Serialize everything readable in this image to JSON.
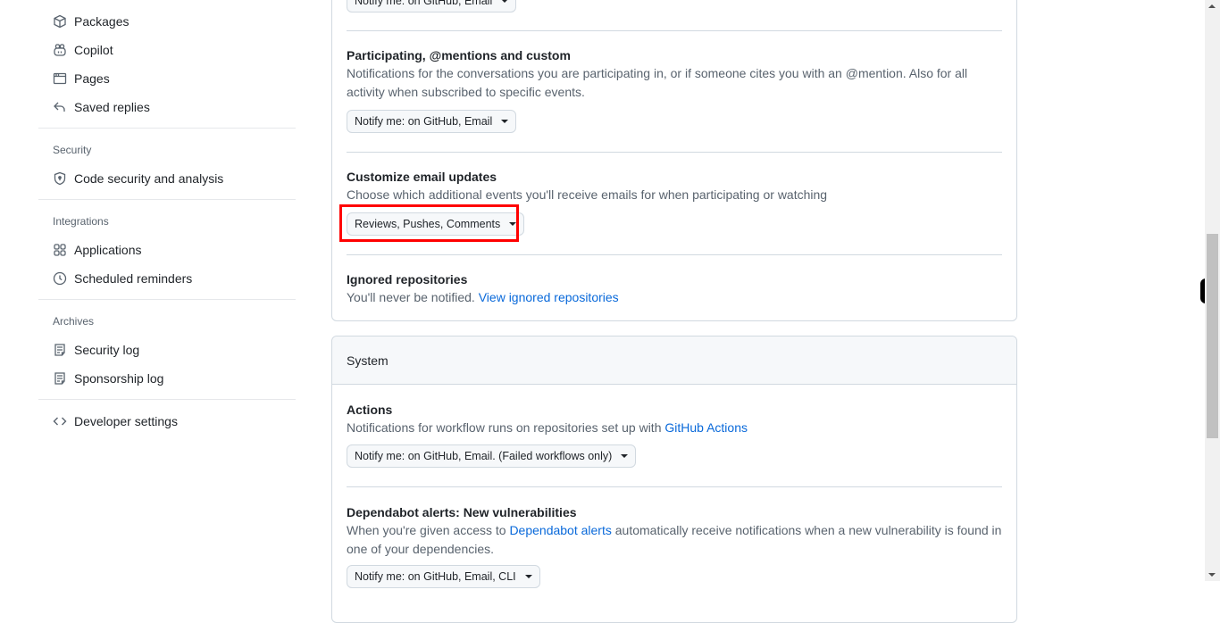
{
  "sidebar": {
    "items_top": [
      {
        "label": "Packages",
        "icon": "package-icon"
      },
      {
        "label": "Copilot",
        "icon": "copilot-icon"
      },
      {
        "label": "Pages",
        "icon": "browser-icon"
      },
      {
        "label": "Saved replies",
        "icon": "reply-icon"
      }
    ],
    "sections": [
      {
        "heading": "Security",
        "items": [
          {
            "label": "Code security and analysis",
            "icon": "shield-lock-icon"
          }
        ]
      },
      {
        "heading": "Integrations",
        "items": [
          {
            "label": "Applications",
            "icon": "apps-icon"
          },
          {
            "label": "Scheduled reminders",
            "icon": "clock-icon"
          }
        ]
      },
      {
        "heading": "Archives",
        "items": [
          {
            "label": "Security log",
            "icon": "log-icon"
          },
          {
            "label": "Sponsorship log",
            "icon": "log-icon"
          }
        ]
      }
    ],
    "developer_settings": {
      "label": "Developer settings",
      "icon": "code-icon"
    }
  },
  "subscriptions_card": {
    "top_select": "Notify me: on GitHub, Email",
    "participating": {
      "title": "Participating, @mentions and custom",
      "description": "Notifications for the conversations you are participating in, or if someone cites you with an @mention. Also for all activity when subscribed to specific events.",
      "select": "Notify me: on GitHub, Email"
    },
    "customize_email": {
      "title": "Customize email updates",
      "description": "Choose which additional events you'll receive emails for when participating or watching",
      "select": "Reviews, Pushes, Comments"
    },
    "ignored": {
      "title": "Ignored repositories",
      "description": "You'll never be notified.",
      "link": "View ignored repositories"
    }
  },
  "system_card": {
    "header": "System",
    "actions": {
      "title": "Actions",
      "description": "Notifications for workflow runs on repositories set up with",
      "link": "GitHub Actions",
      "select": "Notify me: on GitHub, Email. (Failed workflows only)"
    },
    "dependabot": {
      "title": "Dependabot alerts: New vulnerabilities",
      "description_before": "When you're given access to",
      "link": "Dependabot alerts",
      "description_after": "automatically receive notifications when a new vulnerability is found in one of your dependencies.",
      "select": "Notify me: on GitHub, Email, CLI"
    }
  },
  "colors": {
    "link": "#0969da",
    "highlight": "#ff0000",
    "muted_text": "#59636e",
    "border": "#d1d9e0"
  }
}
